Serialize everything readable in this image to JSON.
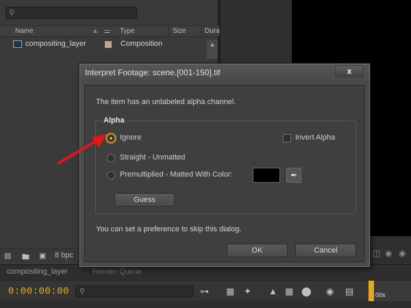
{
  "project": {
    "columns": [
      "Name",
      "Type",
      "Size",
      "Dura"
    ],
    "items": [
      {
        "name": "compositing_layer",
        "type": "Composition"
      }
    ],
    "footer_bpc": "8 bpc"
  },
  "timeline": {
    "tab_label": "compositing_layer",
    "tab2_label": "Render Queue",
    "timecode": "0:00:00:00",
    "ruler_label": "00s"
  },
  "dialog": {
    "title": "Interpret Footage: scene.[001-150].tif",
    "close_glyph": "x",
    "message": "The item has an unlabeled alpha channel.",
    "alpha_group_label": "Alpha",
    "options": [
      {
        "label": "Ignore",
        "selected": true
      },
      {
        "label": "Straight - Unmatted",
        "selected": false
      },
      {
        "label": "Premultiplied - Matted With Color:",
        "selected": false
      }
    ],
    "invert_alpha_label": "Invert Alpha",
    "invert_alpha_checked": false,
    "matte_color": "#000000",
    "guess_label": "Guess",
    "preference_text": "You can set a preference to skip this dialog.",
    "ok_label": "OK",
    "cancel_label": "Cancel"
  },
  "colors": {
    "accent": "#e3b226",
    "annotation_arrow": "#e0161b"
  }
}
